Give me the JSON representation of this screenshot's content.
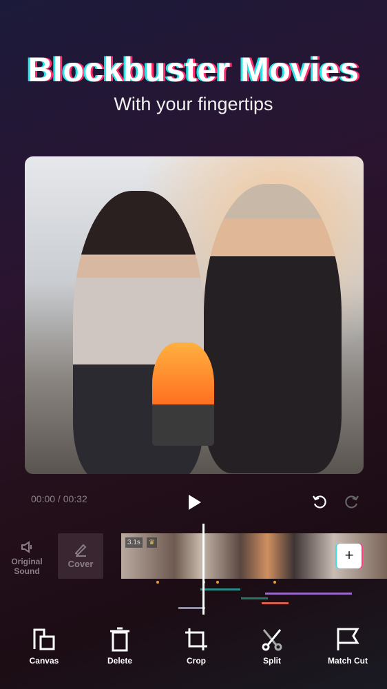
{
  "headline": {
    "title": "Blockbuster Movies",
    "subtitle": "With your fingertips"
  },
  "player": {
    "time": "00:00 / 00:32",
    "icons": [
      "play-icon",
      "undo-icon",
      "redo-icon"
    ]
  },
  "timeline": {
    "original_sound": "Original Sound",
    "cover": "Cover",
    "clip_duration": "3.1s",
    "add_label": "+",
    "track_colors": [
      "#2a8a86",
      "#9a6ac8",
      "#1f7a66",
      "#d8604a",
      "#8890b0"
    ],
    "marker_color": "#f0a030"
  },
  "toolbar": {
    "items": [
      {
        "label": "Canvas",
        "icon": "canvas-icon"
      },
      {
        "label": "Delete",
        "icon": "trash-icon"
      },
      {
        "label": "Crop",
        "icon": "crop-icon"
      },
      {
        "label": "Split",
        "icon": "scissors-icon"
      },
      {
        "label": "Match Cut",
        "icon": "flag-icon"
      }
    ]
  }
}
